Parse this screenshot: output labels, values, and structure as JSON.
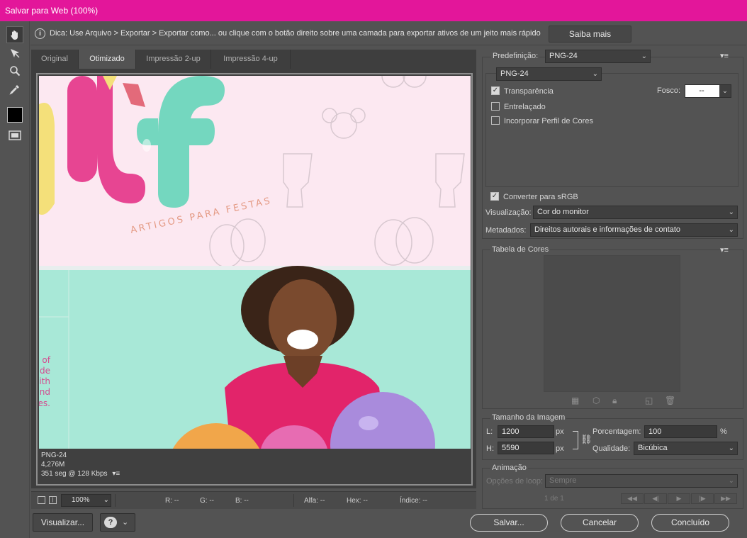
{
  "window": {
    "title": "Salvar para Web (100%)"
  },
  "tip": {
    "text": "Dica: Use Arquivo > Exportar > Exportar como...  ou clique com o botão direito sobre uma camada para exportar ativos de um jeito mais rápido",
    "learn_more": "Saiba mais"
  },
  "tools": [
    "hand-icon",
    "slice-select-icon",
    "zoom-icon",
    "eyedropper-icon",
    "eyedropper-color-swatch",
    "toggle-slices-icon"
  ],
  "tabs": [
    {
      "label": "Original"
    },
    {
      "label": "Otimizado"
    },
    {
      "label": "Impressão 2-up"
    },
    {
      "label": "Impressão 4-up"
    }
  ],
  "active_tab": "Otimizado",
  "preview": {
    "image_text": "ARTIGOS PARA FESTAS",
    "side_text": [
      "of",
      "de",
      "lith",
      "nd",
      "es."
    ],
    "format": "PNG-24",
    "size": "4,276M",
    "time": "351 seg @ 128 Kbps"
  },
  "status": {
    "zoom": "100%",
    "r": "R: --",
    "g": "G: --",
    "b": "B: --",
    "alpha": "Alfa: --",
    "hex": "Hex: --",
    "index": "Índice: --"
  },
  "buttons": {
    "visualize": "Visualizar...",
    "save": "Salvar...",
    "cancel": "Cancelar",
    "done": "Concluído"
  },
  "settings": {
    "preset_label": "Predefinição:",
    "preset_value": "PNG-24",
    "format_value": "PNG-24",
    "transparency": {
      "label": "Transparência",
      "checked": true
    },
    "matte_label": "Fosco:",
    "matte_value": "--",
    "interlaced": {
      "label": "Entrelaçado",
      "checked": false
    },
    "embed_profile": {
      "label": "Incorporar Perfil de Cores",
      "checked": false
    },
    "convert_srgb": {
      "label": "Converter para sRGB",
      "checked": true
    },
    "preview_label": "Visualização:",
    "preview_value": "Cor do monitor",
    "metadata_label": "Metadados:",
    "metadata_value": "Direitos autorais e informações de contato"
  },
  "color_table": {
    "title": "Tabela de Cores"
  },
  "image_size": {
    "title": "Tamanho da Imagem",
    "w_label": "L:",
    "w_value": "1200",
    "h_label": "H:",
    "h_value": "5590",
    "unit": "px",
    "percent_label": "Porcentagem:",
    "percent_value": "100",
    "percent_unit": "%",
    "quality_label": "Qualidade:",
    "quality_value": "Bicúbica"
  },
  "animation": {
    "title": "Animação",
    "loop_label": "Opções de loop:",
    "loop_value": "Sempre",
    "frame": "1 de 1"
  },
  "colors": {
    "accent": "#e3169a",
    "panel": "#535353",
    "dark": "#3e3e3e"
  }
}
